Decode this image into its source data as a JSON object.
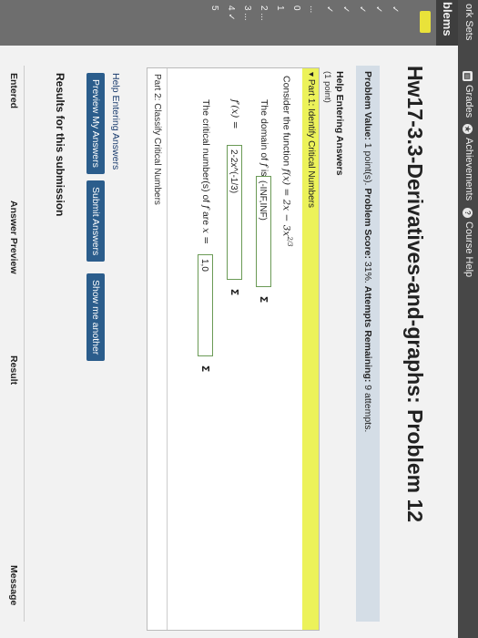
{
  "topnav": {
    "items": [
      {
        "label": "ork Sets",
        "icon": ""
      },
      {
        "label": "Grades",
        "icon": "grades-icon"
      },
      {
        "label": "Achievements",
        "icon": "star-icon"
      },
      {
        "label": "Course Help",
        "icon": "help-icon"
      }
    ]
  },
  "sidebar": {
    "heading": "blems",
    "rows": [
      "✓",
      "✓",
      "✓",
      "✓",
      "✓",
      "...",
      "0",
      "1",
      "2 ...",
      "3 ...",
      "4 ✓",
      "5"
    ]
  },
  "main": {
    "title": "Hw17-3.3-Derivatives-and-graphs: Problem 12",
    "value_label": "Problem Value:",
    "value_text": "1 point(s).",
    "score_label": "Problem Score:",
    "score_text": "31%.",
    "attempts_label": "Attempts Remaining:",
    "attempts_text": "9 attempts.",
    "help_answers": "Help Entering Answers",
    "points": "(1 point)",
    "part1": "Part 1: Identify Critical Numbers",
    "consider_prefix": "Consider the function",
    "function_expr": "f(x) = 2x − 3x",
    "function_exp": "2/3",
    "domain_prefix": "The domain of",
    "domain_f": "f",
    "domain_suffix": "is:",
    "domain_answer": "(-INF,INF)",
    "deriv_prefix": "f′(x) =",
    "deriv_answer": "2-2x^(-1/3)",
    "critical_prefix": "The critical number(s) of",
    "critical_f": "f",
    "critical_suffix": "are",
    "critical_x": "x =",
    "critical_answer": "1,0",
    "sigma": "Σ",
    "part2": "Part 2: Classify Critical Numbers",
    "help_link": "Help Entering Answers",
    "btn_preview": "Preview My Answers",
    "btn_submit": "Submit Answers",
    "btn_show": "Show me another",
    "results_heading": "Results for this submission",
    "col_entered": "Entered",
    "col_preview": "Answer Preview",
    "col_result": "Result",
    "col_message": "Message"
  }
}
